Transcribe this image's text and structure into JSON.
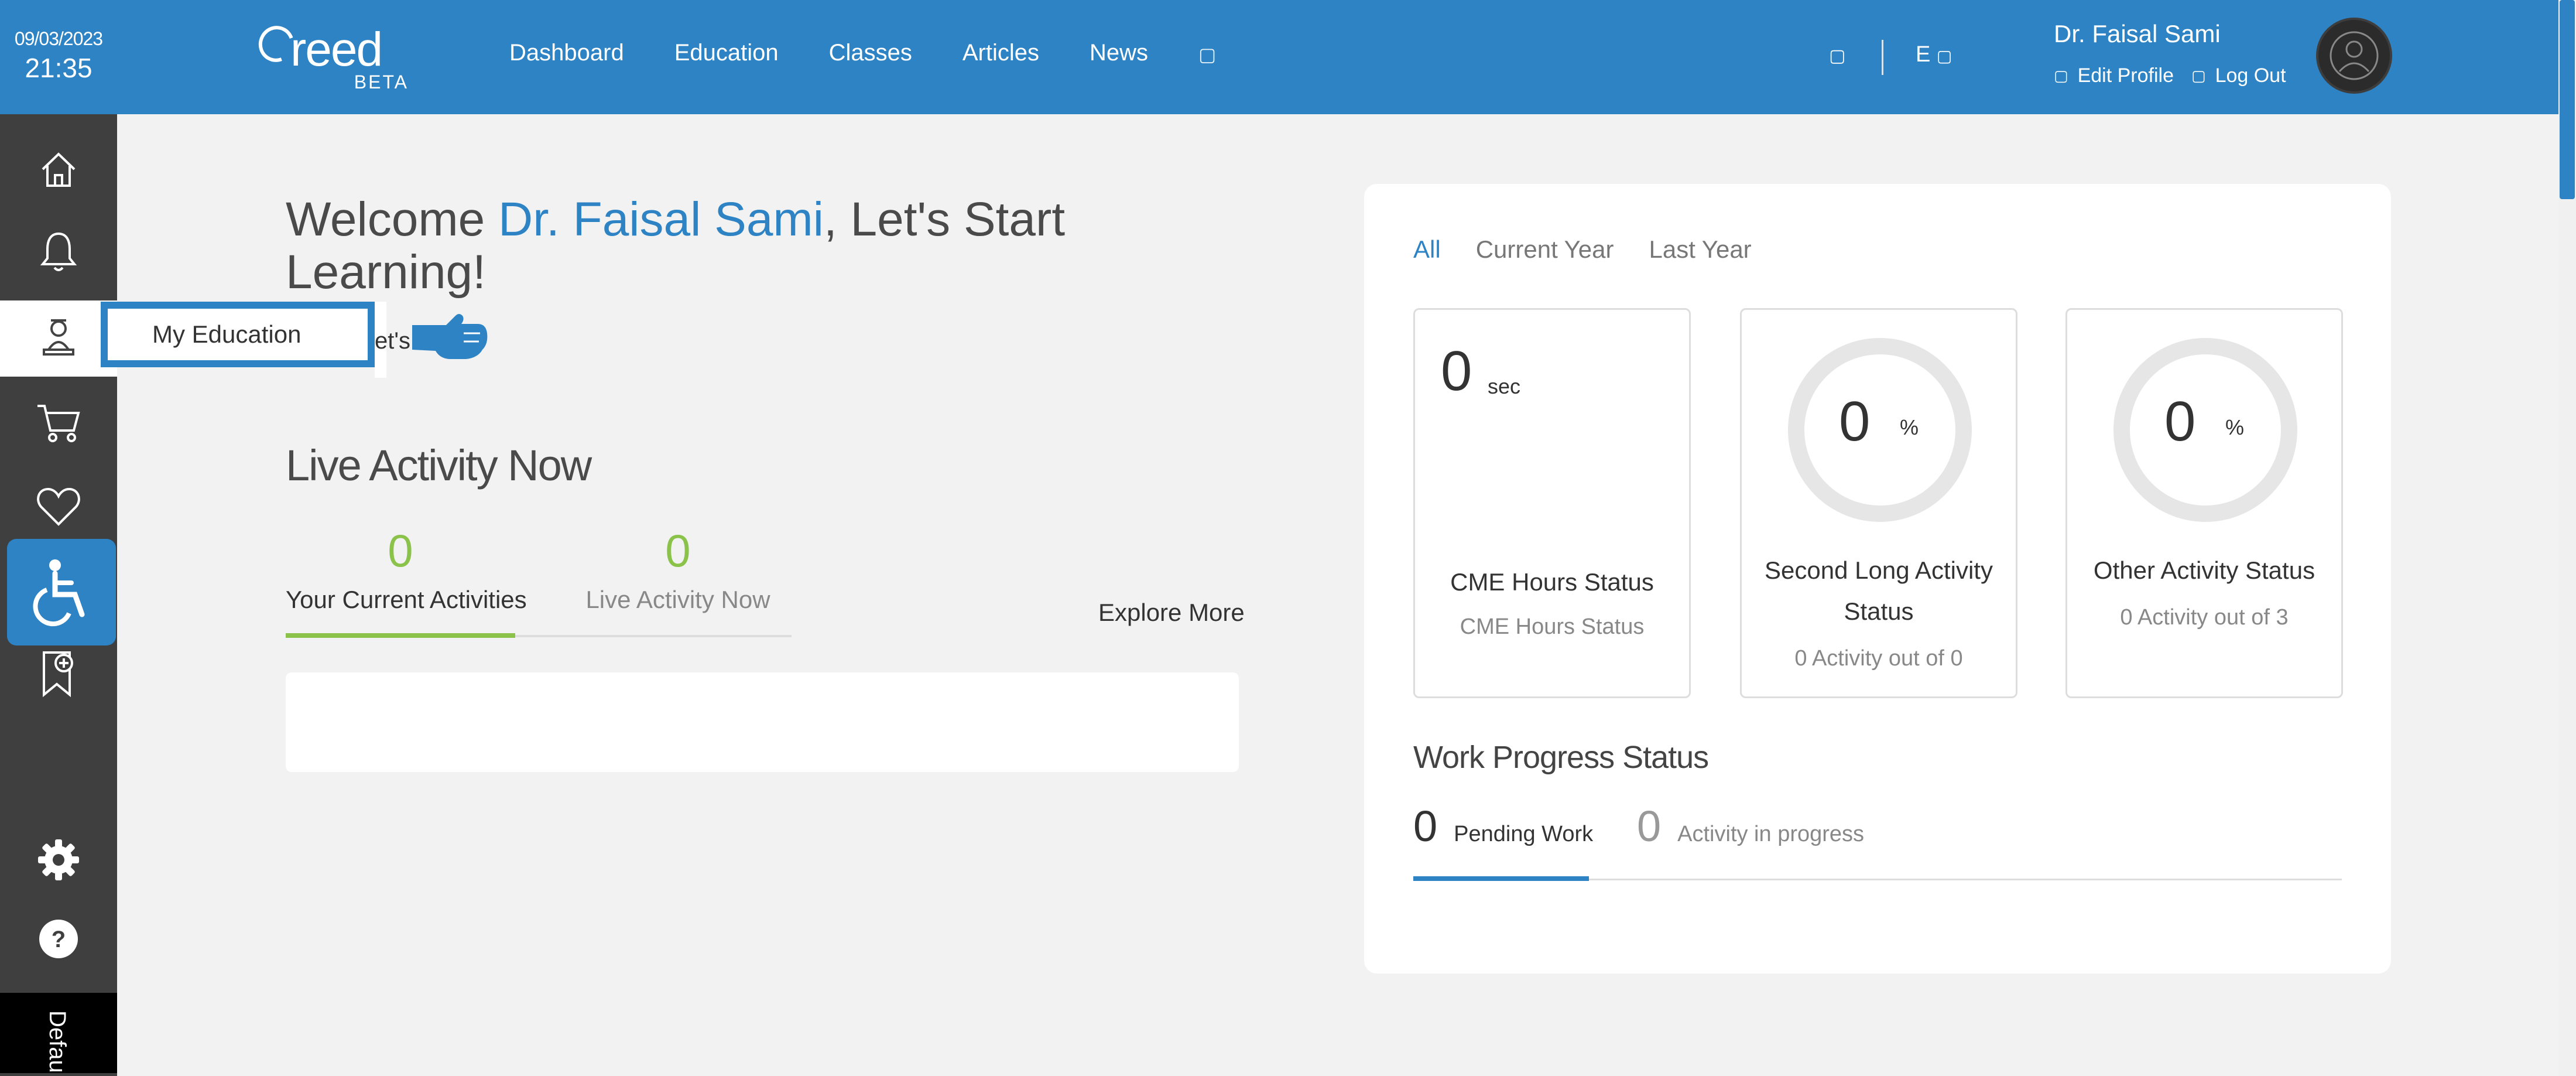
{
  "header": {
    "date": "09/03/2023",
    "time": "21:35",
    "brand": "reed",
    "beta": "BETA",
    "nav": [
      "Dashboard",
      "Education",
      "Classes",
      "Articles",
      "News"
    ],
    "language": "E",
    "user_name": "Dr. Faisal Sami",
    "edit_profile": "Edit Profile",
    "log_out": "Log Out"
  },
  "sidebar": {
    "items": [
      "home-icon",
      "bell-icon",
      "education-icon",
      "cart-icon",
      "heart-icon",
      "accessibility-icon",
      "bookmark-add-icon",
      "gear-icon",
      "help-icon"
    ],
    "tooltip": "My Education",
    "default_label": "Defau"
  },
  "welcome": {
    "prefix": "Welcome ",
    "name": "Dr. Faisal Sami",
    "suffix": ", Let's Start Learning!",
    "sub": "et's le"
  },
  "live_activity": {
    "title": "Live Activity Now",
    "tabs": [
      {
        "count": "0",
        "label": "Your Current Activities"
      },
      {
        "count": "0",
        "label": "Live Activity Now"
      }
    ],
    "explore": "Explore More"
  },
  "stats": {
    "filters": [
      "All",
      "Current Year",
      "Last Year"
    ],
    "cards": [
      {
        "value": "0",
        "unit": "sec",
        "title": "CME Hours Status",
        "subtitle": "CME Hours Status"
      },
      {
        "value": "0",
        "unit": "%",
        "title_line1": "Second Long Activity",
        "title_line2": "Status",
        "subtitle": "0 Activity out of 0"
      },
      {
        "value": "0",
        "unit": "%",
        "title": "Other Activity Status",
        "subtitle": "0 Activity out of 3"
      }
    ]
  },
  "work_progress": {
    "title": "Work Progress Status",
    "items": [
      {
        "count": "0",
        "label": "Pending Work"
      },
      {
        "count": "0",
        "label": "Activity in progress"
      }
    ]
  },
  "colors": {
    "primary": "#2d83c4",
    "sidebar": "#3f3f3f",
    "green": "#8bc34a",
    "background": "#f2f2f2"
  }
}
